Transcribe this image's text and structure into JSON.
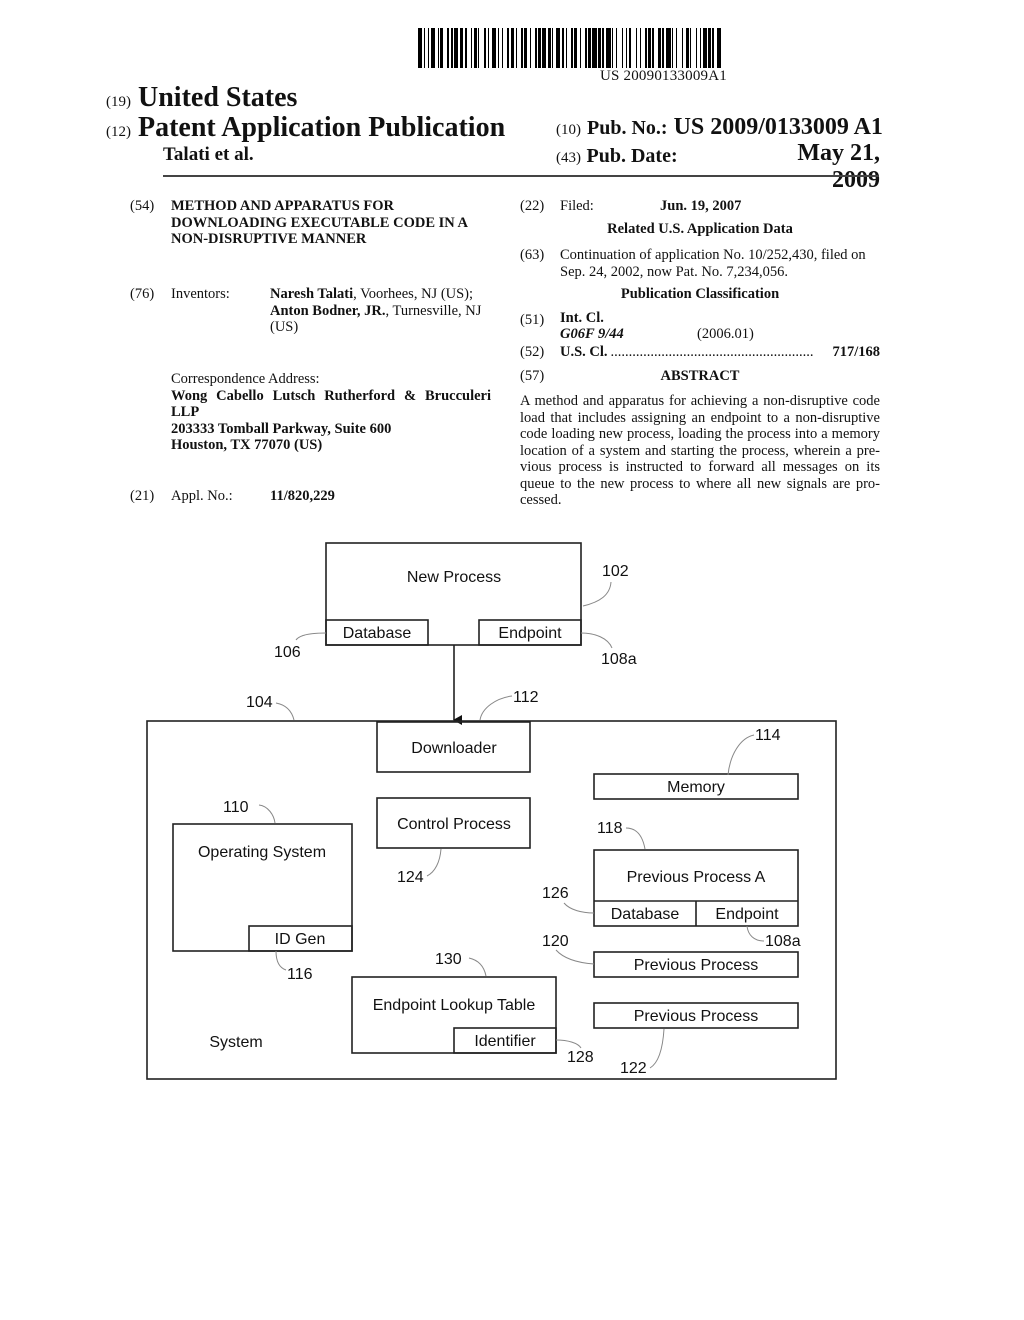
{
  "header": {
    "barcode_number": "US 20090133009A1",
    "country_code": "(19)",
    "country": "United States",
    "type_code": "(12)",
    "type": "Patent Application Publication",
    "authors": "Talati et al.",
    "pub_no_code": "(10)",
    "pub_no_label": "Pub. No.:",
    "pub_no": "US 2009/0133009 A1",
    "pub_date_code": "(43)",
    "pub_date_label": "Pub. Date:",
    "pub_date": "May 21, 2009"
  },
  "left": {
    "title_code": "(54)",
    "title_lines": [
      "METHOD AND APPARATUS FOR",
      "DOWNLOADING EXECUTABLE CODE IN A",
      "NON-DISRUPTIVE MANNER"
    ],
    "inventors_code": "(76)",
    "inventors_label": "Inventors:",
    "inventor1_name": "Naresh Talati",
    "inventor1_loc": ", Voorhees, NJ (US);",
    "inventor2_name": "Anton Bodner, JR.",
    "inventor2_loc": ", Turnesville, NJ",
    "inventor2_loc2": "(US)",
    "corr_label": "Correspondence Address:",
    "corr_lines": [
      "Wong Cabello Lutsch Rutherford & Brucculeri",
      "LLP",
      "203333 Tomball Parkway, Suite 600",
      "Houston, TX 77070 (US)"
    ],
    "appl_code": "(21)",
    "appl_label": "Appl. No.:",
    "appl_no": "11/820,229"
  },
  "right": {
    "filed_code": "(22)",
    "filed_label": "Filed:",
    "filed_date": "Jun. 19, 2007",
    "related_heading": "Related U.S. Application Data",
    "cont_code": "(63)",
    "cont_line1": "Continuation of application No. 10/252,430, filed on",
    "cont_line2": "Sep. 24, 2002, now Pat. No. 7,234,056.",
    "pubclass_heading": "Publication Classification",
    "intcl_code": "(51)",
    "intcl_label": "Int. Cl.",
    "intcl_class": "G06F 9/44",
    "intcl_ver": "(2006.01)",
    "uscl_code": "(52)",
    "uscl_label": "U.S. Cl.",
    "uscl_dots": "........................................................",
    "uscl_value": "717/168",
    "abstract_code": "(57)",
    "abstract_heading": "ABSTRACT",
    "abstract_lines": [
      "A method and apparatus for achieving a non-disruptive code",
      "load that includes assigning an endpoint to a non-disruptive",
      "code loading new process, loading the process into a memory",
      "location of a system and starting the process, wherein a pre-",
      "vious process is instructed to forward all messages on its",
      "queue to the new process to where all new signals are pro-",
      "cessed."
    ]
  },
  "diagram": {
    "new_process": "New Process",
    "np_database": "Database",
    "np_endpoint": "Endpoint",
    "downloader": "Downloader",
    "memory": "Memory",
    "operating_system": "Operating System",
    "id_gen": "ID Gen",
    "control_process": "Control Process",
    "prev_process_a": "Previous Process A",
    "ppa_database": "Database",
    "ppa_endpoint": "Endpoint",
    "prev_process_1": "Previous Process",
    "prev_process_2": "Previous Process",
    "lookup_table": "Endpoint Lookup Table",
    "identifier": "Identifier",
    "system": "System",
    "refs": {
      "r102": "102",
      "r106": "106",
      "r108a_top": "108a",
      "r104": "104",
      "r112": "112",
      "r114": "114",
      "r110": "110",
      "r118": "118",
      "r124": "124",
      "r126": "126",
      "r108a_mid": "108a",
      "r120": "120",
      "r116": "116",
      "r130": "130",
      "r128": "128",
      "r122": "122"
    }
  }
}
